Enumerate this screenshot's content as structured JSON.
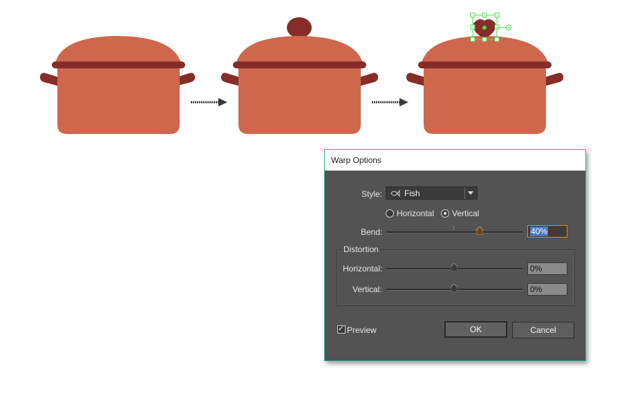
{
  "canvas": {
    "colors": {
      "pot": "#cf674d",
      "band": "#862d29",
      "knob": "#862d29",
      "arrow": "#4a4a4a",
      "selection": "#3de04a"
    },
    "icons": [
      "arrow-right-icon",
      "arrow-right-icon"
    ]
  },
  "dialog": {
    "title": "Warp Options",
    "style_label": "Style:",
    "style_value": "Fish",
    "style_icon": "fish-icon",
    "orientation": {
      "horizontal_label": "Horizontal",
      "vertical_label": "Vertical",
      "selected": "Vertical"
    },
    "bend": {
      "label": "Bend:",
      "value": "40%",
      "level_percent": 40
    },
    "distortion": {
      "title": "Distortion",
      "horizontal": {
        "label": "Horizontal:",
        "value": "0%",
        "level_percent": 0
      },
      "vertical": {
        "label": "Vertical:",
        "value": "0%",
        "level_percent": 0
      }
    },
    "preview": {
      "label": "Preview",
      "checked": true
    },
    "ok_label": "OK",
    "cancel_label": "Cancel",
    "colors": {
      "panel": "#535353",
      "border": "#2bb5a5",
      "focus": "#e08a2e",
      "selection": "#3b7bd6"
    }
  }
}
